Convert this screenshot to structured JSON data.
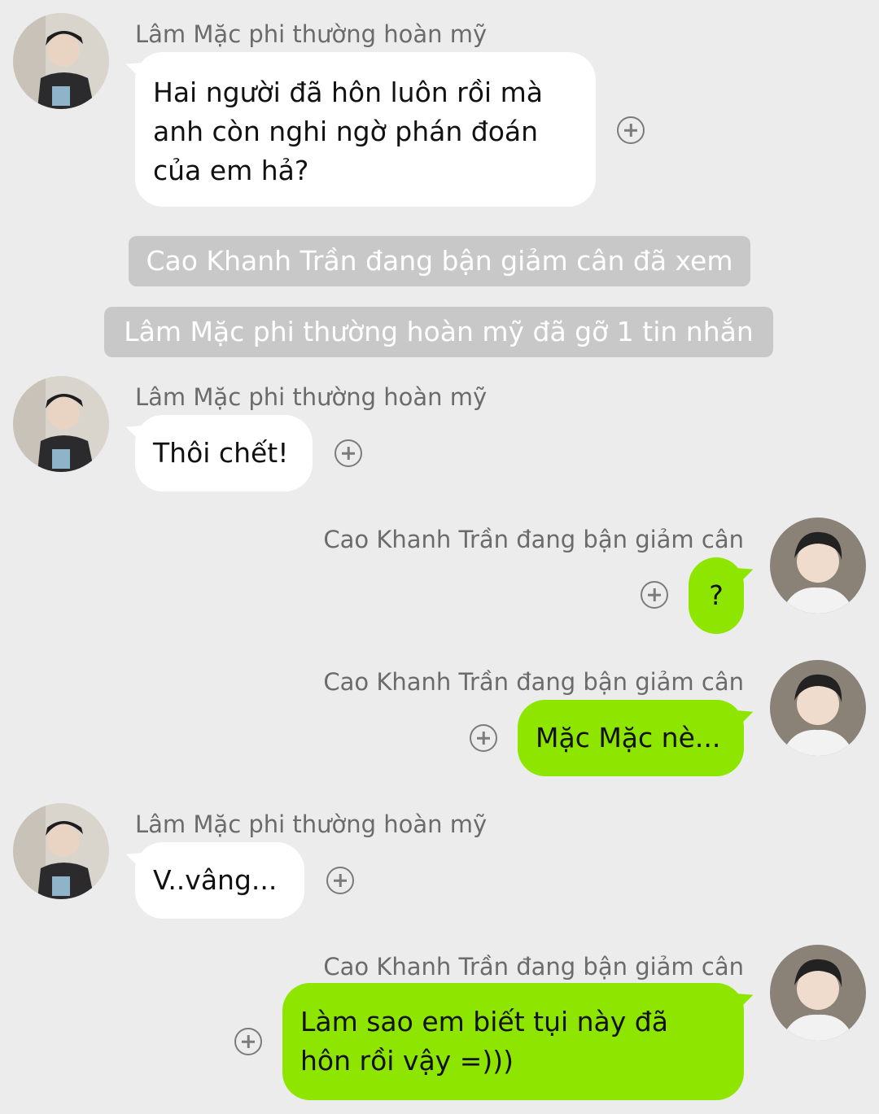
{
  "contacts": {
    "other": {
      "name": "Lâm Mặc phi thường hoàn mỹ"
    },
    "me": {
      "name": "Cao Khanh Trần đang bận giảm cân"
    }
  },
  "messages": [
    {
      "from": "other",
      "sender": "Lâm Mặc phi thường hoàn mỹ",
      "text": "Hai người đã hôn luôn rồi mà\nanh còn nghi ngờ phán đoán\ncủa em hả?"
    },
    {
      "type": "system",
      "text": "Cao Khanh Trần đang bận giảm cân đã xem"
    },
    {
      "type": "system",
      "text": "Lâm Mặc phi thường hoàn mỹ đã gỡ 1 tin nhắn"
    },
    {
      "from": "other",
      "sender": "Lâm Mặc phi thường hoàn mỹ",
      "text": "Thôi chết!"
    },
    {
      "from": "me",
      "sender": "Cao Khanh Trần đang bận giảm cân",
      "text": "?"
    },
    {
      "from": "me",
      "sender": "Cao Khanh Trần đang bận giảm cân",
      "text": "Mặc Mặc nè..."
    },
    {
      "from": "other",
      "sender": "Lâm Mặc phi thường hoàn mỹ",
      "text": "V..vâng..."
    },
    {
      "from": "me",
      "sender": "Cao Khanh Trần đang bận giảm cân",
      "text": "Làm sao em biết tụi này đã\nhôn rồi vậy =)))"
    }
  ],
  "icons": {
    "add_reaction": "plus-circle-icon",
    "avatar_other": "avatar-icon",
    "avatar_me": "avatar-icon"
  },
  "colors": {
    "background": "#ececec",
    "incoming_bubble": "#ffffff",
    "outgoing_bubble": "#8ee600",
    "system_notice": "#c8c8c8",
    "sender_text": "#6b6b6b"
  }
}
